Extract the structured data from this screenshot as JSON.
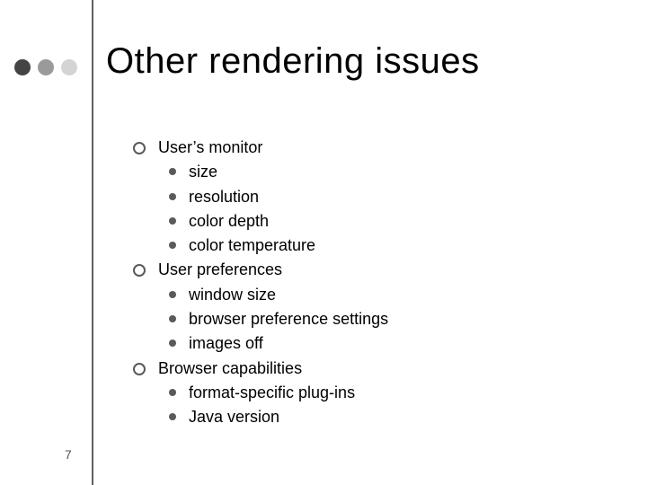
{
  "title": "Other rendering issues",
  "page_number": "7",
  "bullets": [
    {
      "level": 1,
      "text": "User’s monitor"
    },
    {
      "level": 2,
      "text": "size"
    },
    {
      "level": 2,
      "text": "resolution"
    },
    {
      "level": 2,
      "text": "color depth"
    },
    {
      "level": 2,
      "text": "color temperature"
    },
    {
      "level": 1,
      "text": "User preferences"
    },
    {
      "level": 2,
      "text": "window size"
    },
    {
      "level": 2,
      "text": "browser preference settings"
    },
    {
      "level": 2,
      "text": "images off"
    },
    {
      "level": 1,
      "text": "Browser capabilities"
    },
    {
      "level": 2,
      "text": "format-specific plug-ins"
    },
    {
      "level": 2,
      "text": "Java version"
    }
  ]
}
